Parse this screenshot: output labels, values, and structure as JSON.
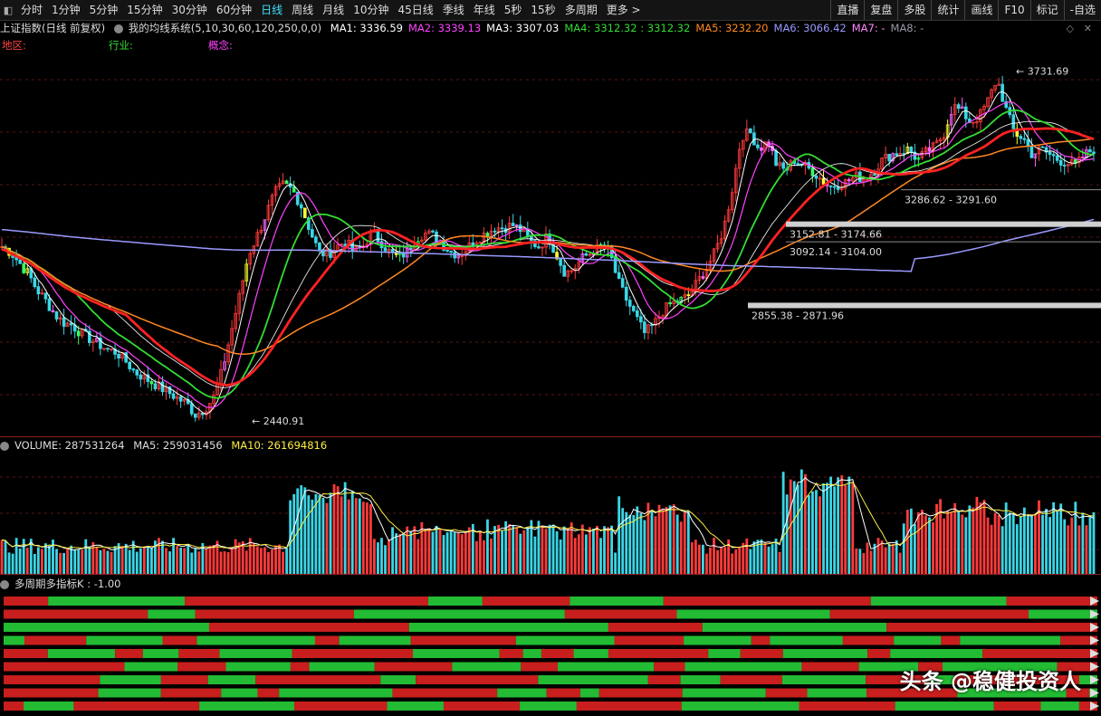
{
  "toolbar": {
    "periods": [
      "分时",
      "1分钟",
      "5分钟",
      "15分钟",
      "30分钟",
      "60分钟",
      "日线",
      "周线",
      "月线",
      "10分钟",
      "45日线",
      "季线",
      "年线",
      "5秒",
      "15秒",
      "多周期",
      "更多 >"
    ],
    "active": "日线",
    "right": [
      "直播",
      "复盘",
      "多股",
      "统计",
      "画线",
      "F10",
      "标记",
      "-自选"
    ]
  },
  "main_panel": {
    "title": "上证指数(日线 前复权)",
    "system": "我的均线系统(5,10,30,60,120,250,0,0)",
    "ma": [
      {
        "label": "MA1: 3336.59",
        "color": "#ffffff"
      },
      {
        "label": "MA2: 3339.13",
        "color": "#ff44ff"
      },
      {
        "label": "MA3: 3307.03",
        "color": "#ffffff"
      },
      {
        "label": "MA4: 3312.32 : 3312.32",
        "color": "#33dd33"
      },
      {
        "label": "MA5: 3232.20",
        "color": "#ff8822"
      },
      {
        "label": "MA6: 3066.42",
        "color": "#9a9aff"
      },
      {
        "label": "MA7: -",
        "color": "#ff88ff"
      },
      {
        "label": "MA8: -",
        "color": "#9999aa"
      }
    ],
    "categories": {
      "region": "地区:",
      "industry": "行业:",
      "concept": "概念:"
    },
    "annotations": {
      "high": "3731.69",
      "low": "2440.91",
      "zone1": "3286.62 - 3291.60",
      "zone2": "3152.81 - 3174.66",
      "zone3": "3092.14 - 3104.00",
      "zone4": "2855.38 - 2871.96"
    }
  },
  "volume_panel": {
    "label": "VOLUME: 287531264",
    "ma5": "MA5: 259031456",
    "ma10": "MA10: 261694816"
  },
  "indicator_panel": {
    "label": "多周期多指标K : -1.00"
  },
  "watermark": "头条 @稳健投资人",
  "chart_data": {
    "type": "line",
    "title": "上证指数(日线 前复权)",
    "high": 3731.69,
    "low": 2440.91,
    "zones": [
      [
        3286.62,
        3291.6
      ],
      [
        3152.81,
        3174.66
      ],
      [
        3092.14,
        3104.0
      ],
      [
        2855.38,
        2871.96
      ]
    ],
    "y_range": [
      2380,
      3790
    ],
    "close_series": [
      3080,
      3060,
      3020,
      2980,
      2920,
      2880,
      2830,
      2800,
      2790,
      2760,
      2740,
      2720,
      2700,
      2690,
      2660,
      2620,
      2600,
      2580,
      2560,
      2540,
      2520,
      2500,
      2460,
      2480,
      2520,
      2620,
      2760,
      2900,
      3050,
      3120,
      3200,
      3280,
      3310,
      3290,
      3230,
      3140,
      3060,
      3050,
      3080,
      3100,
      3060,
      3080,
      3130,
      3100,
      3060,
      3040,
      3060,
      3110,
      3130,
      3120,
      3090,
      3060,
      3050,
      3080,
      3110,
      3130,
      3150,
      3150,
      3160,
      3140,
      3100,
      3080,
      3120,
      3050,
      2980,
      3000,
      3040,
      3060,
      3080,
      3060,
      2950,
      2880,
      2820,
      2760,
      2790,
      2840,
      2870,
      2880,
      2900,
      2950,
      3000,
      3060,
      3150,
      3300,
      3490,
      3500,
      3440,
      3470,
      3380,
      3360,
      3400,
      3380,
      3360,
      3330,
      3300,
      3310,
      3320,
      3340,
      3330,
      3360,
      3400,
      3420,
      3430,
      3440,
      3400,
      3430,
      3450,
      3500,
      3600,
      3580,
      3540,
      3560,
      3620,
      3700,
      3590,
      3500,
      3480,
      3420,
      3440,
      3420,
      3400,
      3390,
      3380,
      3420,
      3440
    ]
  }
}
